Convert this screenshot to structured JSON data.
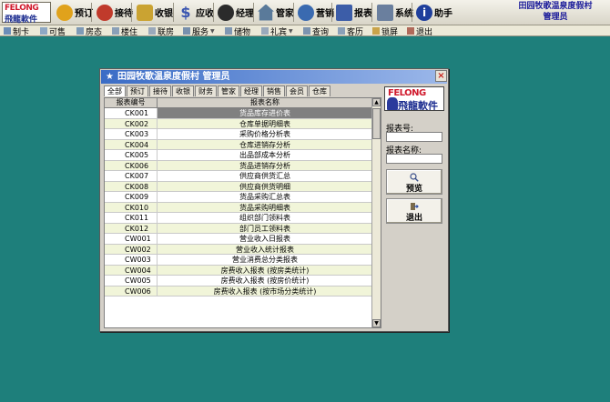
{
  "toolbar": {
    "logo_line1": "FELONG",
    "logo_line2": "飛龍軟件",
    "buttons": [
      {
        "label": "预订",
        "color": "#e0a21c"
      },
      {
        "label": "接待",
        "color": "#c03a2b"
      },
      {
        "label": "收银",
        "color": "#caa332"
      },
      {
        "label": "应收",
        "color": "#3a55b0"
      },
      {
        "label": "经理",
        "color": "#2b2b2b"
      },
      {
        "label": "管家",
        "color": "#5a7a9a"
      },
      {
        "label": "营销",
        "color": "#3a6ab0"
      },
      {
        "label": "报表",
        "color": "#3c5da8"
      },
      {
        "label": "系统",
        "color": "#6a7f9e"
      },
      {
        "label": "助手",
        "color": "#1f3f9c"
      }
    ],
    "org_line1": "田园牧歌温泉度假村",
    "org_line2": "管理员"
  },
  "menu": [
    {
      "label": "制卡",
      "arrow": false
    },
    {
      "label": "可售",
      "arrow": false
    },
    {
      "label": "房态",
      "arrow": false
    },
    {
      "label": "楼住",
      "arrow": false
    },
    {
      "label": "联房",
      "arrow": false
    },
    {
      "label": "服务",
      "arrow": true
    },
    {
      "label": "储物",
      "arrow": false
    },
    {
      "label": "礼宾",
      "arrow": true
    },
    {
      "label": "查询",
      "arrow": false
    },
    {
      "label": "客历",
      "arrow": false
    },
    {
      "label": "锁屏",
      "arrow": false
    },
    {
      "label": "退出",
      "arrow": false
    }
  ],
  "dialog": {
    "title": "田园牧歌温泉度假村 管理员",
    "tabs": [
      "全部",
      "预订",
      "接待",
      "收银",
      "财务",
      "管家",
      "经理",
      "销售",
      "会员",
      "仓库"
    ],
    "active_tab": "全部",
    "columns": [
      "报表编号",
      "报表名称"
    ],
    "rows": [
      [
        "CK001",
        "货品库存进价表"
      ],
      [
        "CK002",
        "仓库单据明细表"
      ],
      [
        "CK003",
        "采购价格分析表"
      ],
      [
        "CK004",
        "仓库进销存分析"
      ],
      [
        "CK005",
        "出品部成本分析"
      ],
      [
        "CK006",
        "货品进销存分析"
      ],
      [
        "CK007",
        "供应商供货汇总"
      ],
      [
        "CK008",
        "供应商供货明细"
      ],
      [
        "CK009",
        "货品采购汇总表"
      ],
      [
        "CK010",
        "货品采购明细表"
      ],
      [
        "CK011",
        "组织部门领料表"
      ],
      [
        "CK012",
        "部门员工领料表"
      ],
      [
        "CW001",
        "营业收入日报表"
      ],
      [
        "CW002",
        "营业收入统计报表"
      ],
      [
        "CW003",
        "营业消费总分类报表"
      ],
      [
        "CW004",
        "房费收入报表 (按房类统计)"
      ],
      [
        "CW005",
        "房费收入报表 (按房价统计)"
      ],
      [
        "CW006",
        "房费收入报表 (按市场分类统计)"
      ]
    ],
    "selected_row": 0,
    "brand_line1": "FELONG",
    "brand_line2": "飛龍軟件",
    "report_no_label": "报表号:",
    "report_no_value": "",
    "report_name_label": "报表名称:",
    "report_name_value": "",
    "preview_label": "预览",
    "exit_label": "退出"
  }
}
